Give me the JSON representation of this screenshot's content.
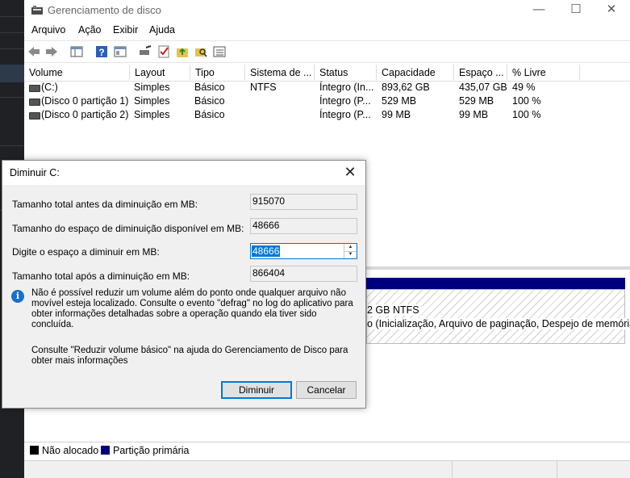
{
  "window": {
    "title": "Gerenciamento de disco",
    "controls": {
      "minimize": "—",
      "maximize": "☐",
      "close": "✕"
    }
  },
  "menu": [
    "Arquivo",
    "Ação",
    "Exibir",
    "Ajuda"
  ],
  "table": {
    "columns": [
      "Volume",
      "Layout",
      "Tipo",
      "Sistema de ...",
      "Status",
      "Capacidade",
      "Espaço ...",
      "% Livre"
    ],
    "rows": [
      {
        "volume": "(C:)",
        "layout": "Simples",
        "tipo": "Básico",
        "fs": "NTFS",
        "status": "Íntegro (In...",
        "capacidade": "893,62 GB",
        "espaco": "435,07 GB",
        "livre": "49 %"
      },
      {
        "volume": "(Disco 0 partição 1)",
        "layout": "Simples",
        "tipo": "Básico",
        "fs": "",
        "status": "Íntegro (P...",
        "capacidade": "529 MB",
        "espaco": "529 MB",
        "livre": "100 %"
      },
      {
        "volume": "(Disco 0 partição 2)",
        "layout": "Simples",
        "tipo": "Básico",
        "fs": "",
        "status": "Íntegro (P...",
        "capacidade": "99 MB",
        "espaco": "99 MB",
        "livre": "100 %"
      }
    ]
  },
  "graph": {
    "partition_line1": "2 GB NTFS",
    "partition_line2": "o (Inicialização, Arquivo de paginação, Despejo de memória, P"
  },
  "legend": [
    {
      "label": "Não alocado",
      "color": "#000000"
    },
    {
      "label": "Partição primária",
      "color": "#00007f"
    }
  ],
  "dialog": {
    "title": "Diminuir C:",
    "close": "✕",
    "fields": [
      {
        "label": "Tamanho total antes da diminuição em MB:",
        "value": "915070"
      },
      {
        "label": "Tamanho do espaço de diminuição disponível em MB:",
        "value": "48666"
      },
      {
        "label": "Digite o espaço a diminuir em MB:",
        "value": "48666"
      },
      {
        "label": "Tamanho total após a diminuição em MB:",
        "value": "866404"
      }
    ],
    "info": "Não é possível reduzir um volume além do ponto onde qualquer arquivo não movível esteja localizado. Consulte o evento \"defrag\" no log do aplicativo para obter informações detalhadas sobre a operação quando ela tiver sido concluída.",
    "help": "Consulte \"Reduzir volume básico\" na ajuda do Gerenciamento de Disco para obter mais informações",
    "buttons": {
      "ok": "Diminuir",
      "cancel": "Cancelar"
    }
  }
}
